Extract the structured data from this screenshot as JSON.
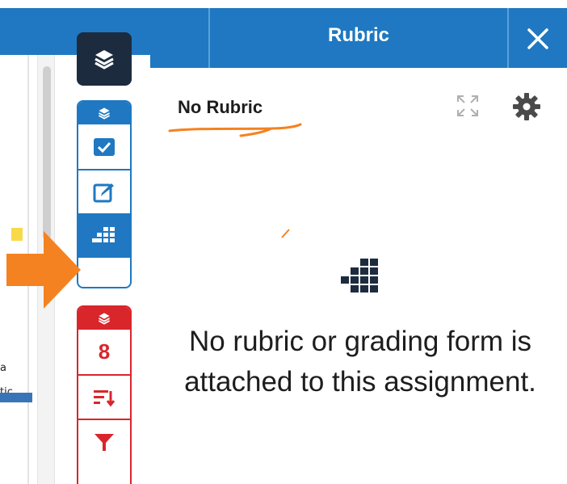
{
  "panel": {
    "title": "Rubric",
    "rubric_selection": "No Rubric",
    "empty_message": "No rubric or grading form is attached to this assignment."
  },
  "rail": {
    "score_count": "8",
    "items": [
      {
        "icon": "layers-icon"
      },
      {
        "icon": "layers-icon"
      },
      {
        "icon": "checkbox-icon"
      },
      {
        "icon": "edit-icon"
      },
      {
        "icon": "grid-icon"
      },
      {
        "icon": "layers-icon"
      },
      {
        "icon": "sort-icon"
      },
      {
        "icon": "filter-icon"
      }
    ]
  },
  "document": {
    "fragment_1": "a",
    "fragment_2": "tic"
  },
  "colors": {
    "accent_blue": "#1f78c1",
    "dark_navy": "#1d2b3f",
    "alert_red": "#d9262b",
    "annotation_orange": "#f58220"
  }
}
